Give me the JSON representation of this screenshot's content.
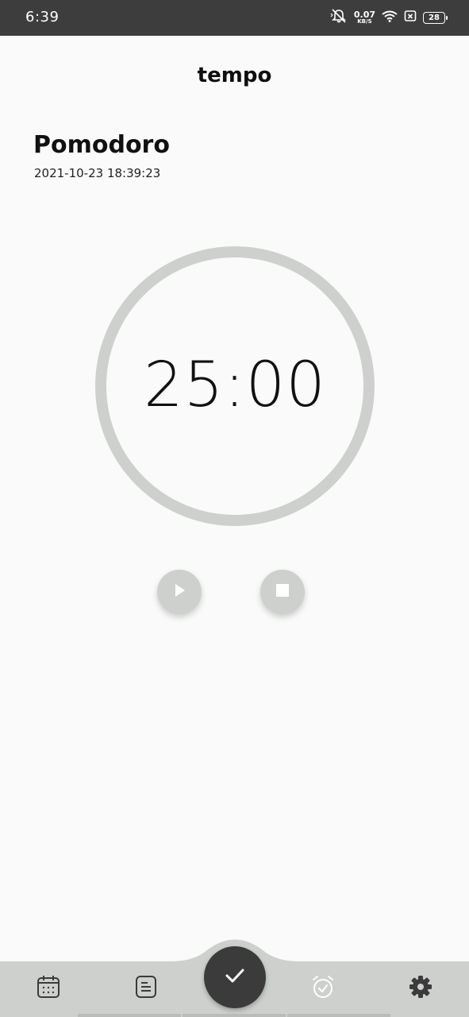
{
  "status_bar": {
    "time": "6:39",
    "net_speed_value": "0.07",
    "net_speed_unit": "KB/S",
    "battery_level": "28"
  },
  "header": {
    "app_title": "tempo"
  },
  "task": {
    "title": "Pomodoro",
    "datetime": "2021-10-23 18:39:23"
  },
  "timer": {
    "display": "25:00",
    "ring_color": "#cdd0cd"
  },
  "controls": {
    "play_icon": "play-icon",
    "stop_icon": "stop-icon"
  },
  "bottom_nav": {
    "items": [
      {
        "icon": "calendar-icon"
      },
      {
        "icon": "notes-icon"
      },
      {
        "icon": "alarm-check-icon"
      },
      {
        "icon": "gear-icon"
      }
    ],
    "fab_icon": "check-icon",
    "background_color": "#cdd0cd",
    "fab_color": "#3b3b3b"
  }
}
